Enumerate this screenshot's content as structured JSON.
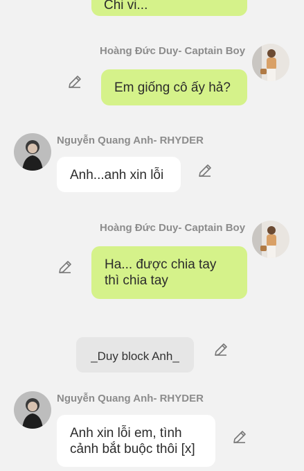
{
  "messages": [
    {
      "sender": "",
      "text": "Chi vi..."
    },
    {
      "sender": "Hoàng Đức Duy- Captain Boy",
      "text": "Em giống cô ấy hả?"
    },
    {
      "sender": "Nguyễn Quang Anh- RHYDER",
      "text": "Anh...anh xin lỗi"
    },
    {
      "sender": "Hoàng Đức Duy- Captain Boy",
      "text_lines": [
        "Ha... được chia tay",
        "thì chia tay"
      ]
    },
    {
      "system": "_Duy block Anh_"
    },
    {
      "sender": "Nguyễn Quang Anh- RHYDER",
      "text_lines": [
        "Anh xin lỗi em, tình",
        "cảnh bắt buộc thôi [x]"
      ]
    }
  ],
  "icons": {
    "edit": "pencil-icon"
  },
  "colors": {
    "me_bubble": "#d5f28a",
    "other_bubble": "#ffffff",
    "system_bubble": "#e6e6e6",
    "background": "#f2f2f2"
  }
}
